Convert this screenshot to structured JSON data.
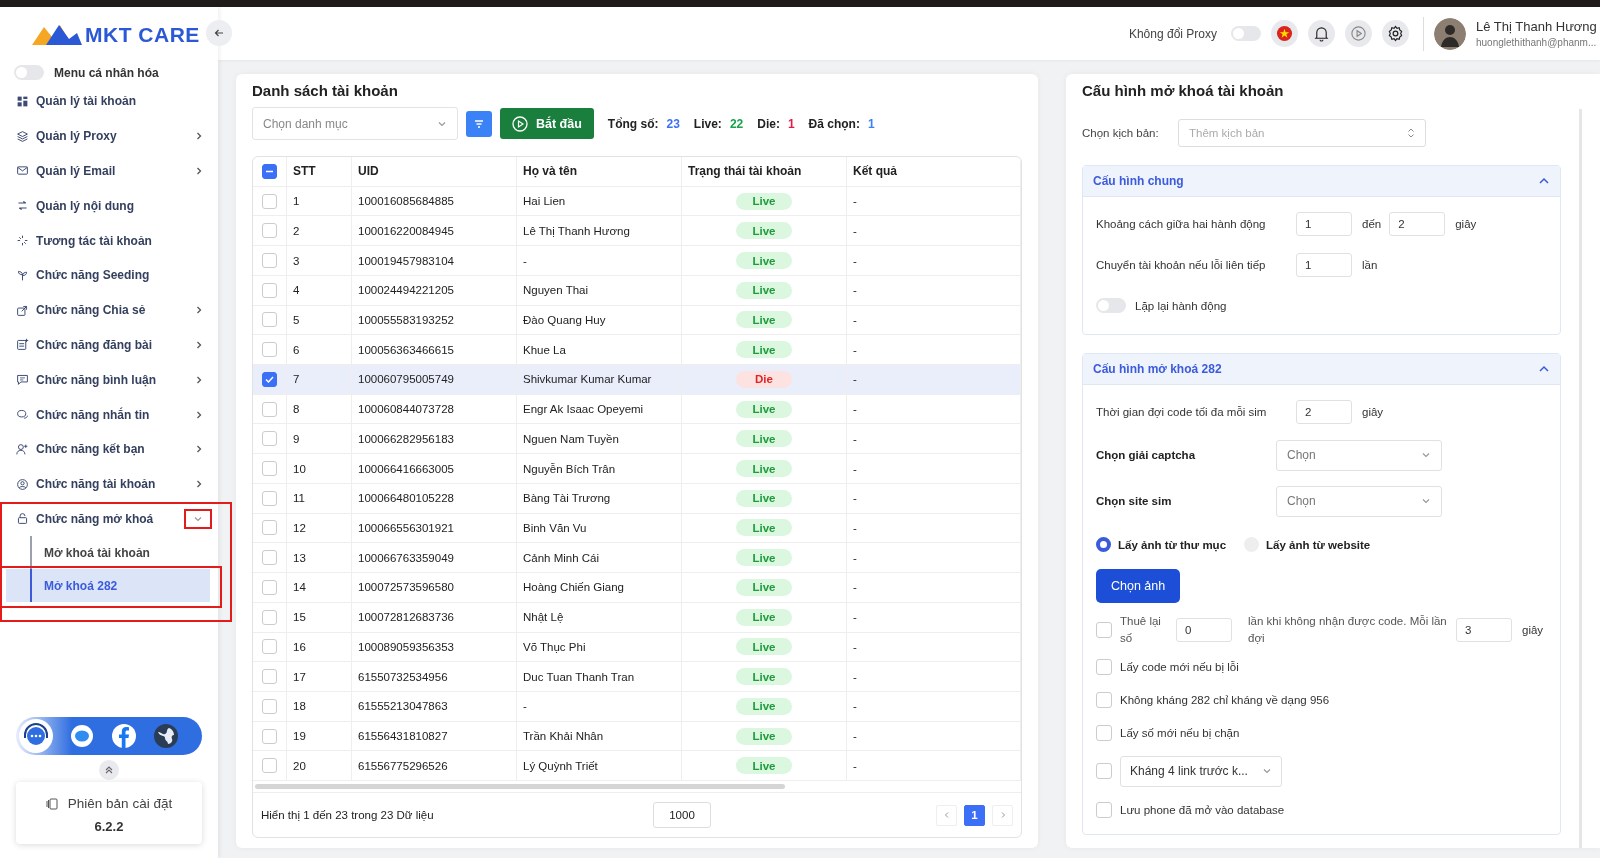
{
  "sidebar": {
    "logo": "MKT CARE",
    "personal_menu": {
      "label": "Menu cá nhân hóa",
      "on": false
    },
    "items": [
      {
        "label": "Quản lý tài khoản",
        "expandable": false,
        "marked": false
      },
      {
        "label": "Quản lý Proxy",
        "expandable": true,
        "expanded": false,
        "marked": false
      },
      {
        "label": "Quản lý Email",
        "expandable": true,
        "expanded": false,
        "marked": false
      },
      {
        "label": "Quản lý nội dung",
        "expandable": false,
        "marked": false
      },
      {
        "label": "Tương tác tài khoản",
        "expandable": false,
        "marked": false
      },
      {
        "label": "Chức năng Seeding",
        "expandable": false,
        "marked": false
      },
      {
        "label": "Chức năng Chia sẻ",
        "expandable": true,
        "expanded": false,
        "marked": false
      },
      {
        "label": "Chức năng đăng bài",
        "expandable": true,
        "expanded": false,
        "marked": false
      },
      {
        "label": "Chức năng bình luận",
        "expandable": true,
        "expanded": false,
        "marked": false
      },
      {
        "label": "Chức năng nhắn tin",
        "expandable": true,
        "expanded": false,
        "marked": false
      },
      {
        "label": "Chức năng kết bạn",
        "expandable": true,
        "expanded": false,
        "marked": false
      },
      {
        "label": "Chức năng tài khoản",
        "expandable": true,
        "expanded": false,
        "marked": false
      },
      {
        "label": "Chức năng mở khoá",
        "expandable": true,
        "expanded": true,
        "marked": true,
        "chevron_marked": true,
        "children": [
          {
            "label": "Mở khoá tài khoản",
            "selected": false,
            "marked": false
          },
          {
            "label": "Mở khoá 282",
            "selected": true,
            "marked": true
          }
        ]
      }
    ],
    "version": {
      "label": "Phiên bản cài đặt",
      "value": "6.2.2"
    }
  },
  "header": {
    "proxy_toggle": {
      "label": "Không đổi Proxy",
      "on": false
    },
    "user": {
      "name": "Lê Thị Thanh Hương",
      "email": "huonglethithanh@phanm..."
    }
  },
  "accounts": {
    "title": "Danh sách tài khoản",
    "category": {
      "placeholder": "Chọn danh mục"
    },
    "start_button": "Bắt đầu",
    "stats": [
      {
        "label": "Tổng số:",
        "value": "23",
        "color": "#3b6ff5"
      },
      {
        "label": "Live:",
        "value": "22",
        "color": "#16a34a"
      },
      {
        "label": "Die:",
        "value": "1",
        "color": "#e11d48"
      },
      {
        "label": "Đã chọn:",
        "value": "1",
        "color": "#3b82f6"
      }
    ],
    "table": {
      "select_all_checked": true,
      "select_all_partial": true,
      "columns": [
        "STT",
        "UID",
        "Họ và tên",
        "Trạng thái tài khoản",
        "Kết quả"
      ],
      "rows": [
        {
          "stt": "1",
          "uid": "100016085684885",
          "name": "Hai Lien",
          "status": "Live",
          "status_ok": true,
          "result": "-",
          "selected": false
        },
        {
          "stt": "2",
          "uid": "100016220084945",
          "name": "Lê Thị Thanh Hương",
          "status": "Live",
          "status_ok": true,
          "result": "-",
          "selected": false
        },
        {
          "stt": "3",
          "uid": "100019457983104",
          "name": "-",
          "status": "Live",
          "status_ok": true,
          "result": "-",
          "selected": false
        },
        {
          "stt": "4",
          "uid": "100024494221205",
          "name": "Nguyen Thai",
          "status": "Live",
          "status_ok": true,
          "result": "-",
          "selected": false
        },
        {
          "stt": "5",
          "uid": "100055583193252",
          "name": "Đào Quang Huy",
          "status": "Live",
          "status_ok": true,
          "result": "-",
          "selected": false
        },
        {
          "stt": "6",
          "uid": "100056363466615",
          "name": "Khue La",
          "status": "Live",
          "status_ok": true,
          "result": "-",
          "selected": false
        },
        {
          "stt": "7",
          "uid": "100060795005749",
          "name": "Shivkumar Kumar Kumar",
          "status": "Die",
          "status_ok": false,
          "result": "-",
          "selected": true
        },
        {
          "stt": "8",
          "uid": "100060844073728",
          "name": "Engr Ak Isaac Opeyemi",
          "status": "Live",
          "status_ok": true,
          "result": "-",
          "selected": false
        },
        {
          "stt": "9",
          "uid": "100066282956183",
          "name": "Nguen Nam Tuyền",
          "status": "Live",
          "status_ok": true,
          "result": "-",
          "selected": false
        },
        {
          "stt": "10",
          "uid": "100066416663005",
          "name": "Nguyễn Bích Trân",
          "status": "Live",
          "status_ok": true,
          "result": "-",
          "selected": false
        },
        {
          "stt": "11",
          "uid": "100066480105228",
          "name": "Bàng Tài Trương",
          "status": "Live",
          "status_ok": true,
          "result": "-",
          "selected": false
        },
        {
          "stt": "12",
          "uid": "100066556301921",
          "name": "Binh Văn Vu",
          "status": "Live",
          "status_ok": true,
          "result": "-",
          "selected": false
        },
        {
          "stt": "13",
          "uid": "100066763359049",
          "name": "Cảnh Minh Cái",
          "status": "Live",
          "status_ok": true,
          "result": "-",
          "selected": false
        },
        {
          "stt": "14",
          "uid": "100072573596580",
          "name": "Hoàng Chiến Giang",
          "status": "Live",
          "status_ok": true,
          "result": "-",
          "selected": false
        },
        {
          "stt": "15",
          "uid": "100072812683736",
          "name": "Nhật Lệ",
          "status": "Live",
          "status_ok": true,
          "result": "-",
          "selected": false
        },
        {
          "stt": "16",
          "uid": "100089059356353",
          "name": "Võ Thục Phi",
          "status": "Live",
          "status_ok": true,
          "result": "-",
          "selected": false
        },
        {
          "stt": "17",
          "uid": "61550732534956",
          "name": "Duc Tuan Thanh Tran",
          "status": "Live",
          "status_ok": true,
          "result": "-",
          "selected": false
        },
        {
          "stt": "18",
          "uid": "61555213047863",
          "name": "-",
          "status": "Live",
          "status_ok": true,
          "result": "-",
          "selected": false
        },
        {
          "stt": "19",
          "uid": "61556431810827",
          "name": "Trần Khải Nhân",
          "status": "Live",
          "status_ok": true,
          "result": "-",
          "selected": false
        },
        {
          "stt": "20",
          "uid": "61556775296526",
          "name": "Lý Quỳnh Triết",
          "status": "Live",
          "status_ok": true,
          "result": "-",
          "selected": false
        }
      ]
    },
    "footer": {
      "summary": "Hiển thị 1 đến 23 trong 23 Dữ liệu",
      "page_size": "1000",
      "pages": [
        {
          "label": "1",
          "selected": true
        }
      ]
    }
  },
  "config": {
    "title": "Cấu hình mở khoá tài khoản",
    "script": {
      "label": "Chọn kịch bản:",
      "placeholder": "Thêm kịch bản"
    },
    "sections": [
      {
        "title": "Cấu hình chung",
        "expanded": true,
        "rows": [
          {
            "kind": "range",
            "label": "Khoảng cách giữa hai hành động",
            "from": "1",
            "separator": "đến",
            "to": "2",
            "unit": "giây"
          },
          {
            "kind": "number",
            "label": "Chuyển tài khoản nếu lỗi liên tiếp",
            "value": "1",
            "unit": "lần"
          },
          {
            "kind": "toggle",
            "label": "Lặp lại hành động",
            "on": false
          }
        ]
      },
      {
        "title": "Cấu hình mở khoá 282",
        "expanded": true,
        "rows": [
          {
            "kind": "number",
            "label": "Thời gian đợi code tối đa mỗi sim",
            "value": "2",
            "unit": "giây"
          },
          {
            "kind": "select",
            "label": "Chọn giải captcha",
            "placeholder": "Chọn"
          },
          {
            "kind": "select",
            "label": "Chọn site sim",
            "placeholder": "Chọn"
          },
          {
            "kind": "radio",
            "options": [
              {
                "label": "Lấy ảnh từ thư mục",
                "selected": true
              },
              {
                "label": "Lấy ảnh từ website",
                "selected": false
              }
            ]
          },
          {
            "kind": "button",
            "label": "Chọn ảnh"
          },
          {
            "kind": "rent",
            "checked": false,
            "label": "Thuê lại số",
            "value": "0",
            "text": "lần khi không nhận được code. Mỗi lần đợi",
            "value2": "3",
            "unit": "giây"
          },
          {
            "kind": "check",
            "label": "Lấy code mới nếu bị lỗi",
            "checked": false
          },
          {
            "kind": "check",
            "label": "Không kháng 282 chỉ kháng về dạng 956",
            "checked": false
          },
          {
            "kind": "check",
            "label": "Lấy số mới nếu bị chặn",
            "checked": false
          },
          {
            "kind": "check_select",
            "checked": false,
            "value": "Kháng 4 link trước k..."
          },
          {
            "kind": "check",
            "label": "Lưu phone đã mở vào database",
            "checked": false
          }
        ]
      }
    ]
  }
}
